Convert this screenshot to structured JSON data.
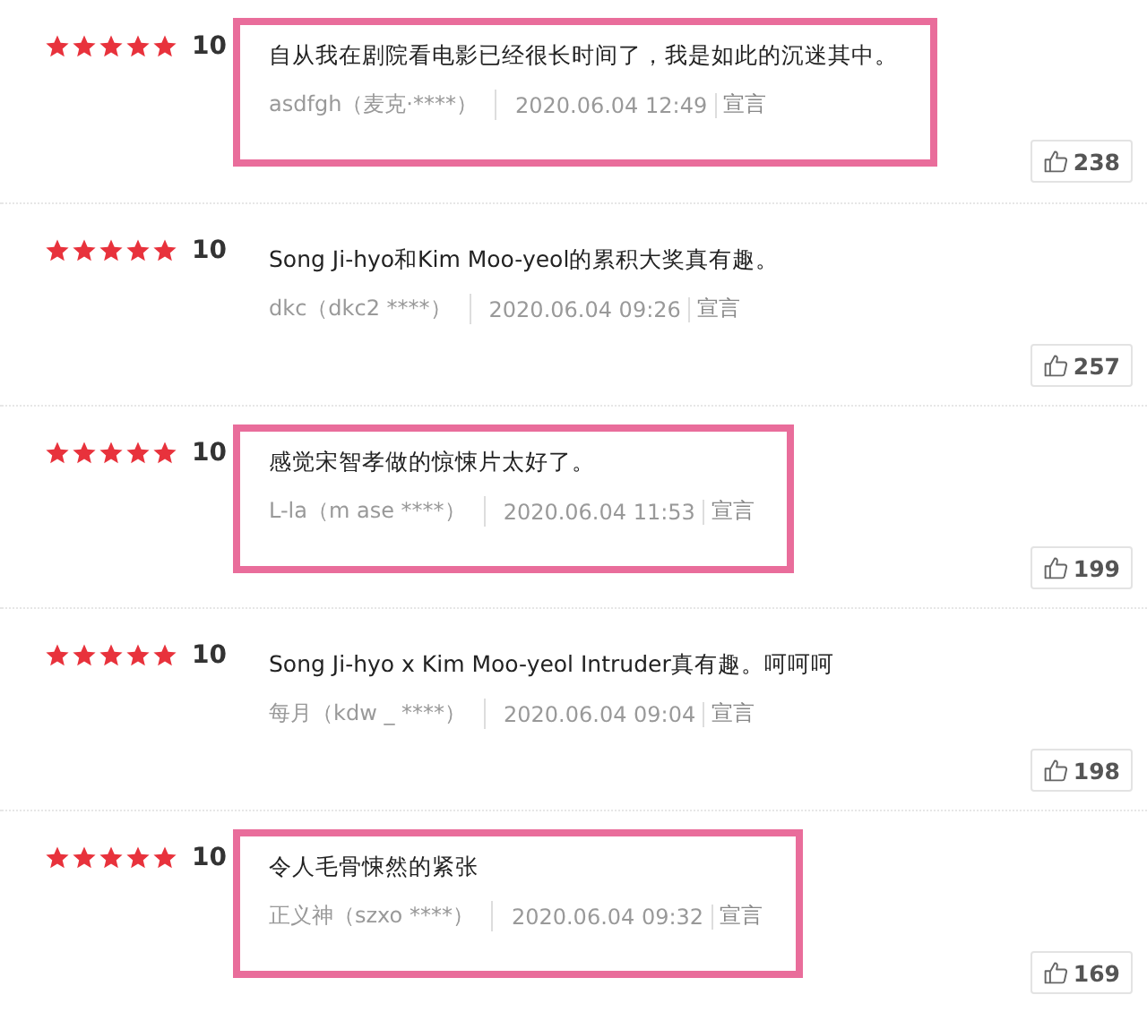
{
  "reviews": [
    {
      "stars": 5,
      "score": "10",
      "text": "自从我在剧院看电影已经很长时间了，我是如此的沉迷其中。",
      "user": "asdfgh（麦克·****）",
      "date": "2020.06.04 12:49",
      "report": "宣言",
      "likes": "238",
      "highlighted": true
    },
    {
      "stars": 5,
      "score": "10",
      "text": "Song Ji-hyo和Kim  Moo-yeol的累积大奖真有趣。",
      "user": "dkc（dkc2 ****）",
      "date": "2020.06.04 09:26",
      "report": "宣言",
      "likes": "257",
      "highlighted": false
    },
    {
      "stars": 5,
      "score": "10",
      "text": "感觉宋智孝做的惊悚片太好了。",
      "user": "L-la（m ase ****）",
      "date": "2020.06.04 11:53",
      "report": "宣言",
      "likes": "199",
      "highlighted": true
    },
    {
      "stars": 5,
      "score": "10",
      "text": "Song Ji-hyo x Kim  Moo-yeol Intruder真有趣。呵呵呵",
      "user": "每月（kdw _ ****）",
      "date": "2020.06.04 09:04",
      "report": "宣言",
      "likes": "198",
      "highlighted": false
    },
    {
      "stars": 5,
      "score": "10",
      "text": "令人毛骨悚然的紧张",
      "user": "正义神（szxo ****）",
      "date": "2020.06.04 09:32",
      "report": "宣言",
      "likes": "169",
      "highlighted": true
    }
  ]
}
